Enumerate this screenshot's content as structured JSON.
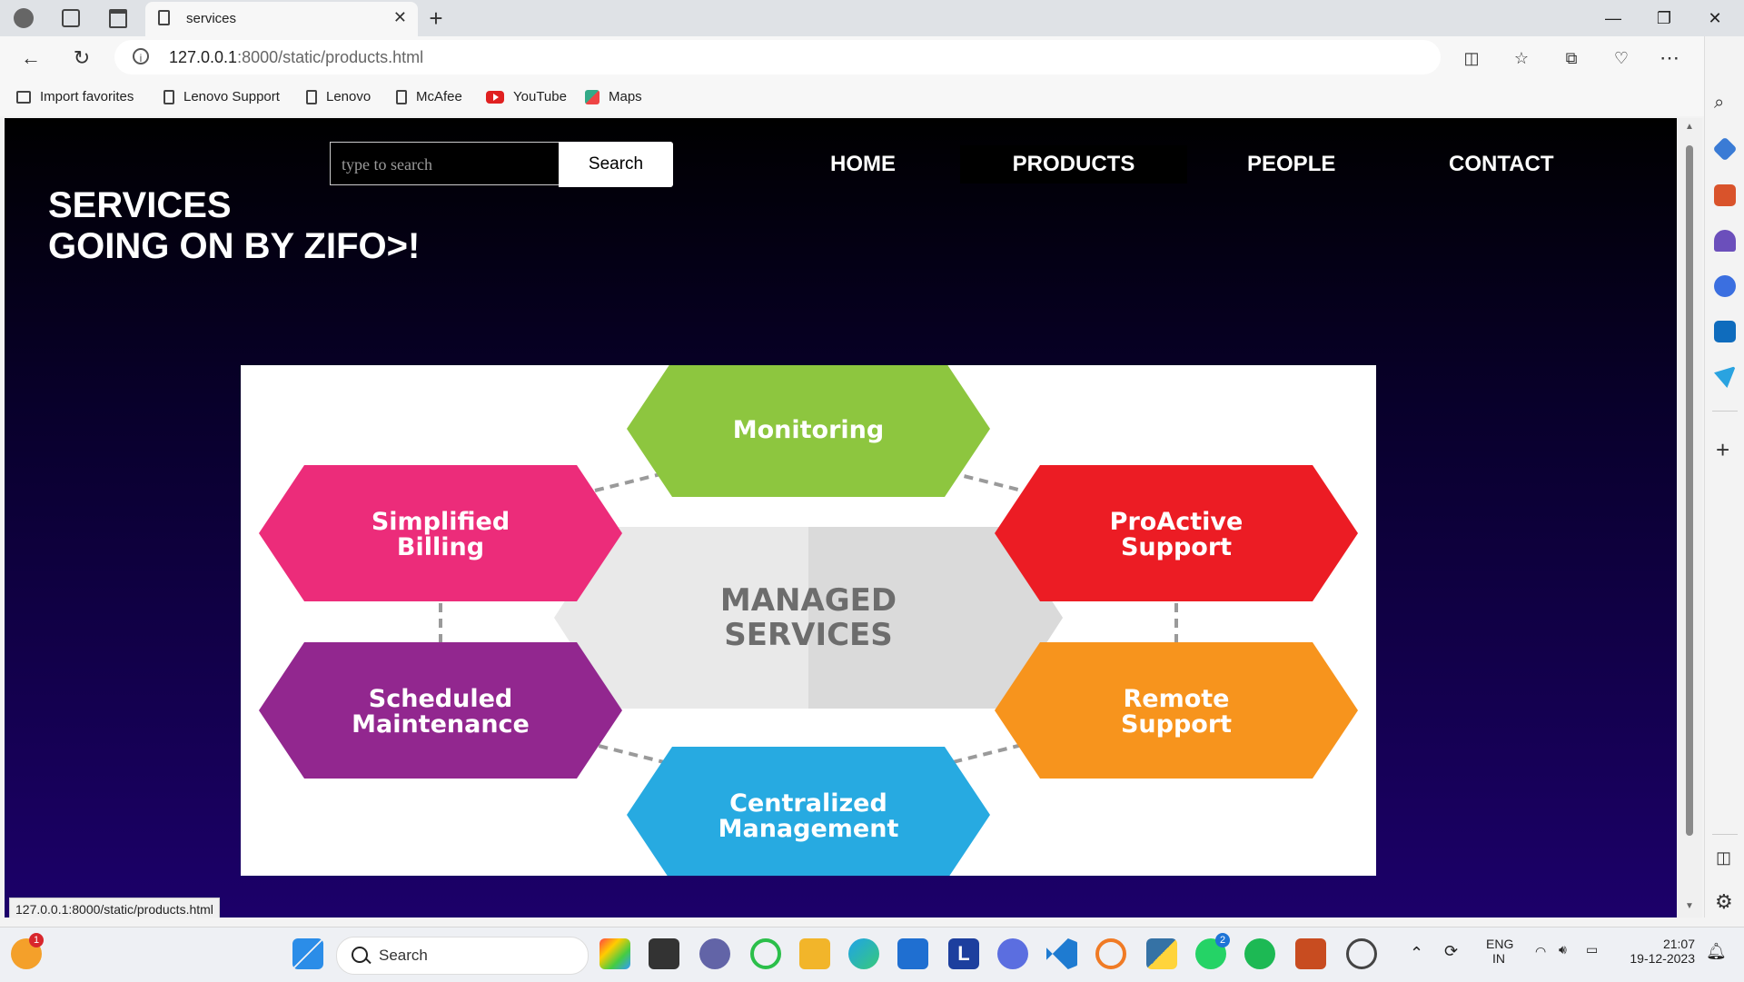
{
  "browser": {
    "tab_title": "services",
    "url_host": "127.0.0.1",
    "url_rest": ":8000/static/products.html",
    "favorites": [
      "Import favorites",
      "Lenovo Support",
      "Lenovo",
      "McAfee",
      "YouTube",
      "Maps"
    ]
  },
  "page": {
    "search_placeholder": "type to search",
    "search_button": "Search",
    "nav": [
      "HOME",
      "PRODUCTS",
      "PEOPLE",
      "CONTACT"
    ],
    "heading_line1": "SERVICES",
    "heading_line2": "GOING ON BY ZIFO>!",
    "diagram": {
      "center_line1": "MANAGED",
      "center_line2": "SERVICES",
      "nodes": [
        {
          "line1": "Monitoring",
          "line2": "",
          "color": "#8dc63f"
        },
        {
          "line1": "ProActive",
          "line2": "Support",
          "color": "#ec1c24"
        },
        {
          "line1": "Remote",
          "line2": "Support",
          "color": "#f7941d"
        },
        {
          "line1": "Centralized",
          "line2": "Management",
          "color": "#27aae1"
        },
        {
          "line1": "Scheduled",
          "line2": "Maintenance",
          "color": "#92278f"
        },
        {
          "line1": "Simplified",
          "line2": "Billing",
          "color": "#ec2c7a"
        }
      ]
    },
    "status_url": "127.0.0.1:8000/static/products.html"
  },
  "taskbar": {
    "search_label": "Search",
    "lang1": "ENG",
    "lang2": "IN",
    "time": "21:07",
    "date": "19-12-2023",
    "whatsapp_badge": "2",
    "weather_badge": "1"
  }
}
